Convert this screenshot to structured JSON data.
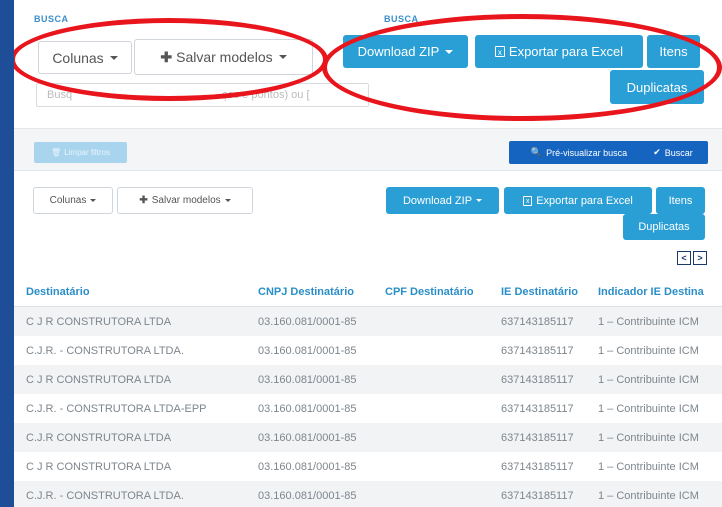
{
  "zoomed": {
    "label_left": "BUSCA",
    "label_right": "BUSCA",
    "columns_label": "Colunas",
    "save_models_label": "Salvar modelos",
    "download_zip_label": "Download ZIP",
    "export_excel_label": "Exportar para Excel",
    "items_label": "Itens",
    "duplicates_label": "Duplicatas",
    "search_placeholder": "Busque (separe por vírgulas, espaços e pontos) ou [",
    "search_left": "Busq",
    "search_right": "ços e pontos) ou ["
  },
  "filters": {
    "clear_label": "Limpar filtros",
    "preview_label": "Pré-visualizar busca",
    "search_label": "Buscar"
  },
  "toolbar": {
    "columns_label": "Colunas",
    "save_models_label": "Salvar modelos",
    "download_zip_label": "Download ZIP",
    "export_excel_label": "Exportar para Excel",
    "items_label": "Itens",
    "duplicates_label": "Duplicatas"
  },
  "icons": {
    "columns_caret": "chevron-down-icon",
    "save_plus": "plus-icon",
    "excel": "excel-icon",
    "trash": "trash-icon",
    "search": "search-icon",
    "check": "check-icon",
    "prev": "chevron-left-icon",
    "next": "chevron-right-icon"
  },
  "colors": {
    "accent_blue": "#2a9fd6",
    "navy": "#1565c0",
    "header_text": "#2a8ec7",
    "annotation_red": "#e8151c",
    "page_border": "#1f4e99"
  },
  "table": {
    "headers": [
      "Destinatário",
      "CNPJ Destinatário",
      "CPF Destinatário",
      "IE Destinatário",
      "Indicador IE Destina"
    ],
    "rows": [
      [
        "C J R CONSTRUTORA LTDA",
        "03.160.081/0001-85",
        "",
        "637143185117",
        "1 – Contribuinte ICM"
      ],
      [
        "C.J.R. - CONSTRUTORA LTDA.",
        "03.160.081/0001-85",
        "",
        "637143185117",
        "1 – Contribuinte ICM"
      ],
      [
        "C J R CONSTRUTORA LTDA",
        "03.160.081/0001-85",
        "",
        "637143185117",
        "1 – Contribuinte ICM"
      ],
      [
        "C.J.R. - CONSTRUTORA LTDA-EPP",
        "03.160.081/0001-85",
        "",
        "637143185117",
        "1 – Contribuinte ICM"
      ],
      [
        "C.J.R CONSTRUTORA LTDA",
        "03.160.081/0001-85",
        "",
        "637143185117",
        "1 – Contribuinte ICM"
      ],
      [
        "C J R CONSTRUTORA LTDA",
        "03.160.081/0001-85",
        "",
        "637143185117",
        "1 – Contribuinte ICM"
      ],
      [
        "C.J.R. - CONSTRUTORA LTDA.",
        "03.160.081/0001-85",
        "",
        "637143185117",
        "1 – Contribuinte ICM"
      ]
    ]
  }
}
